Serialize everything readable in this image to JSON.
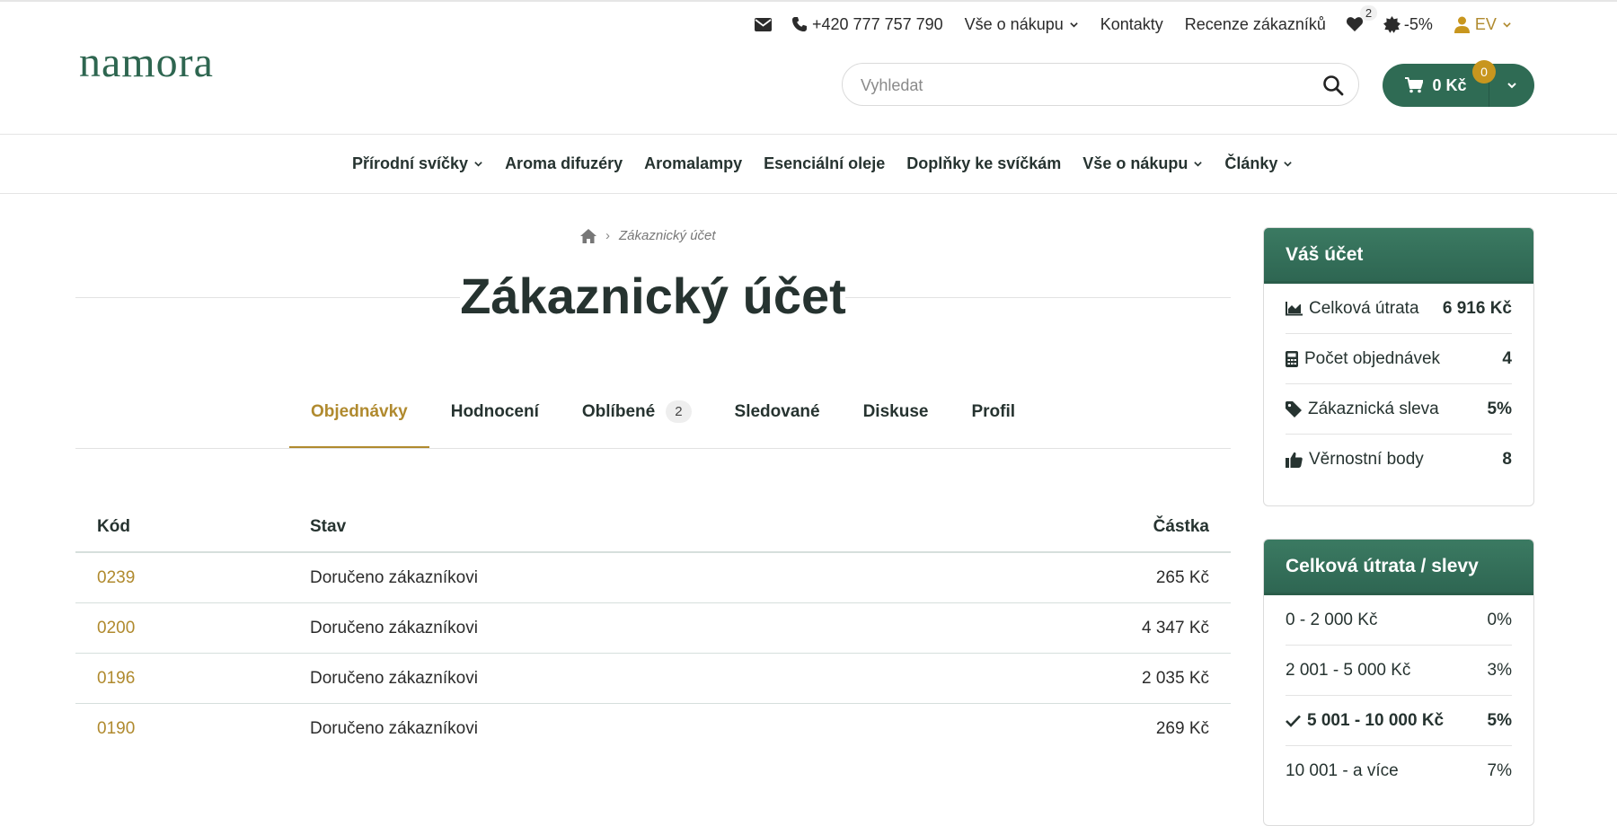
{
  "topbar": {
    "phone": "+420 777 757 790",
    "shopping_info": "Vše o nákupu",
    "contacts": "Kontakty",
    "reviews": "Recenze zákazníků",
    "wishlist_count": "2",
    "discount": "-5%",
    "user_initials": "EV"
  },
  "brand": {
    "logo_text": "namora"
  },
  "search": {
    "placeholder": "Vyhledat"
  },
  "cart": {
    "total": "0 Kč",
    "count": "0"
  },
  "nav": [
    {
      "label": "Přírodní svíčky",
      "dropdown": true
    },
    {
      "label": "Aroma difuzéry",
      "dropdown": false
    },
    {
      "label": "Aromalampy",
      "dropdown": false
    },
    {
      "label": "Esenciální oleje",
      "dropdown": false
    },
    {
      "label": "Doplňky ke svíčkám",
      "dropdown": false
    },
    {
      "label": "Vše o nákupu",
      "dropdown": true
    },
    {
      "label": "Články",
      "dropdown": true
    }
  ],
  "breadcrumb": {
    "current": "Zákaznický účet"
  },
  "page": {
    "title": "Zákaznický účet"
  },
  "tabs": [
    {
      "label": "Objednávky",
      "active": true
    },
    {
      "label": "Hodnocení"
    },
    {
      "label": "Oblíbené",
      "badge": "2"
    },
    {
      "label": "Sledované"
    },
    {
      "label": "Diskuse"
    },
    {
      "label": "Profil"
    }
  ],
  "orders": {
    "headers": {
      "code": "Kód",
      "status": "Stav",
      "amount": "Částka"
    },
    "rows": [
      {
        "code": "0239",
        "status": "Doručeno zákazníkovi",
        "amount": "265 Kč"
      },
      {
        "code": "0200",
        "status": "Doručeno zákazníkovi",
        "amount": "4 347 Kč"
      },
      {
        "code": "0196",
        "status": "Doručeno zákazníkovi",
        "amount": "2 035 Kč"
      },
      {
        "code": "0190",
        "status": "Doručeno zákazníkovi",
        "amount": "269 Kč"
      }
    ]
  },
  "account": {
    "title": "Váš účet",
    "rows": [
      {
        "icon": "chart-area-icon",
        "label": "Celková útrata",
        "value": "6 916 Kč"
      },
      {
        "icon": "calculator-icon",
        "label": "Počet objednávek",
        "value": "4"
      },
      {
        "icon": "tag-icon",
        "label": "Zákaznická sleva",
        "value": "5%"
      },
      {
        "icon": "thumbs-up-icon",
        "label": "Věrnostní body",
        "value": "8"
      }
    ]
  },
  "tiers": {
    "title": "Celková útrata / slevy",
    "rows": [
      {
        "range": "0 - 2 000 Kč",
        "discount": "0%"
      },
      {
        "range": "2 001 - 5 000 Kč",
        "discount": "3%"
      },
      {
        "range": "5 001 - 10 000 Kč",
        "discount": "5%",
        "current": true
      },
      {
        "range": "10 001 - a více",
        "discount": "7%"
      }
    ]
  },
  "colors": {
    "brand_green": "#2f6b54",
    "accent_gold": "#b08a2e",
    "badge_gold": "#c8961e"
  }
}
